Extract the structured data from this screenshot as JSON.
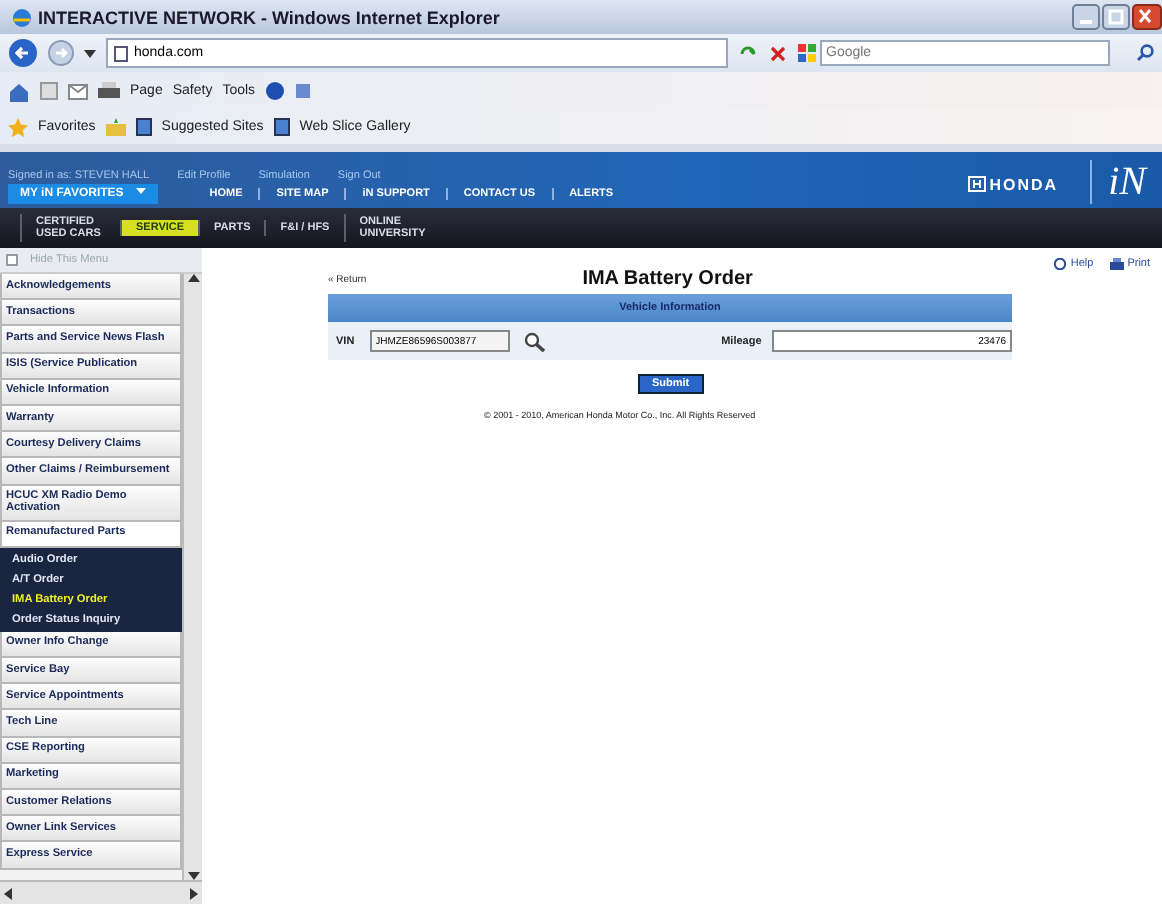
{
  "browser": {
    "title": "INTERACTIVE NETWORK - Windows Internet Explorer",
    "address": "honda.com",
    "search": {
      "placeholder": "Google"
    },
    "commands": [
      "Page",
      "Safety",
      "Tools"
    ],
    "favorites": "Favorites",
    "links": [
      "Suggested Sites",
      "Web Slice Gallery"
    ]
  },
  "site": {
    "user_links": [
      "Signed in as: STEVEN HALL",
      "Edit Profile",
      "Simulation",
      "Sign Out"
    ],
    "favorites_menu": "MY iN FAVORITES",
    "nav": [
      "HOME",
      "SITE MAP",
      "iN SUPPORT",
      "CONTACT US",
      "ALERTS"
    ],
    "brand": "HONDA",
    "logo": "iN",
    "tabs": [
      {
        "label": "CERTIFIED USED CARS",
        "selected": false
      },
      {
        "label": "SERVICE",
        "selected": true
      },
      {
        "label": "PARTS",
        "selected": false
      },
      {
        "label": "F&I / HFS",
        "selected": false
      },
      {
        "label": "ONLINE UNIVERSITY",
        "selected": false
      }
    ]
  },
  "sidebar": {
    "hide_label": "Hide This Menu",
    "items": [
      {
        "label": "Acknowledgements",
        "expanded": false
      },
      {
        "label": "Transactions",
        "expanded": false
      },
      {
        "label": "Parts and Service News Flash",
        "expanded": false
      },
      {
        "label": "ISIS (Service Publication",
        "expanded": false
      },
      {
        "label": "Vehicle Information",
        "expanded": false
      },
      {
        "label": "Warranty",
        "expanded": false
      },
      {
        "label": "Courtesy Delivery Claims",
        "expanded": false
      },
      {
        "label": "Other Claims / Reimbursement",
        "expanded": false
      },
      {
        "label": "HCUC XM Radio Demo Activation",
        "expanded": false
      },
      {
        "label": "Remanufactured Parts",
        "expanded": true,
        "children": [
          {
            "label": "Audio Order",
            "selected": false
          },
          {
            "label": "A/T Order",
            "selected": false
          },
          {
            "label": "IMA Battery Order",
            "selected": true
          },
          {
            "label": "Order Status Inquiry",
            "selected": false
          }
        ]
      },
      {
        "label": "Owner Info Change",
        "expanded": false
      },
      {
        "label": "Service Bay",
        "expanded": false
      },
      {
        "label": "Service Appointments",
        "expanded": false
      },
      {
        "label": "Tech Line",
        "expanded": false
      },
      {
        "label": "CSE Reporting",
        "expanded": false
      },
      {
        "label": "Marketing",
        "expanded": false
      },
      {
        "label": "Customer Relations",
        "expanded": false
      },
      {
        "label": "Owner Link Services",
        "expanded": false
      },
      {
        "label": "Express Service",
        "expanded": false
      }
    ]
  },
  "content": {
    "back_link": "« Return",
    "help": "Help",
    "print": "Print",
    "title": "IMA Battery Order",
    "section": "Vehicle Information",
    "vin": {
      "label": "VIN",
      "value": "JHMZE86596S003877"
    },
    "mileage": {
      "label": "Mileage",
      "value": "23476"
    },
    "submit": "Submit",
    "copyright": "© 2001 - 2010, American Honda Motor Co., Inc. All Rights Reserved"
  }
}
